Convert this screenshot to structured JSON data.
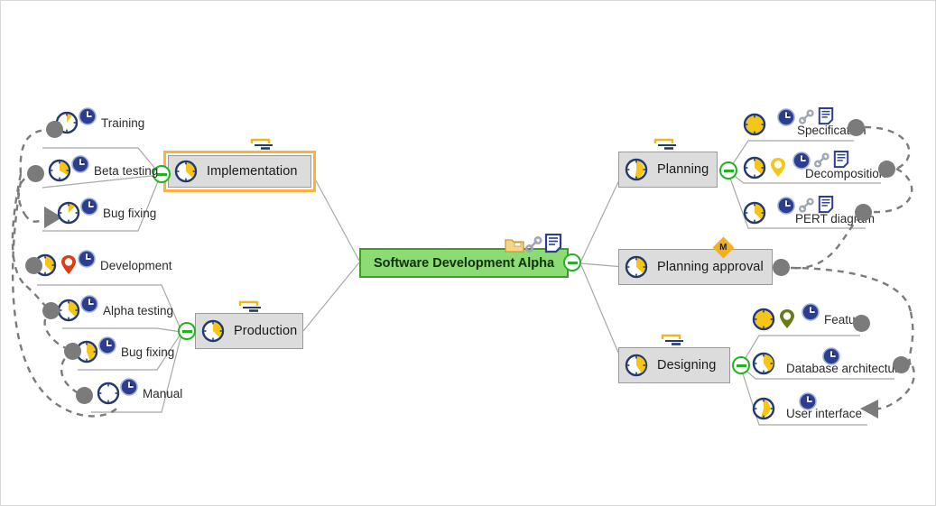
{
  "app": {
    "type": "project-mind-map",
    "background": "#ffffff"
  },
  "colors": {
    "root_fill": "#8ddb74",
    "root_border": "#3d9e26",
    "node_fill": "#dcdcdc",
    "node_border": "#9a9a9a",
    "selection": "#fcb040",
    "collapse": "#23b223",
    "clock_ring": "#22386e",
    "clock_fill": "#f5c518",
    "link_line": "#7b7b7b",
    "branch_line": "#a8a8a8",
    "milestone": "#f2b01e",
    "pin_red": "#e03c12",
    "pin_yellow": "#f5c518",
    "pin_olive": "#6b7a17"
  },
  "root": {
    "label": "Software Development Alpha",
    "progress": 0,
    "icons": [
      "folder-icon",
      "link-icon",
      "note-icon"
    ],
    "collapse_label": "collapse"
  },
  "branches": [
    {
      "id": "implementation",
      "label": "Implementation",
      "selected": true,
      "progress": 30,
      "side": "left",
      "children": [
        {
          "label": "Training",
          "progress": 20,
          "icons": [
            "clock-icon"
          ],
          "endpoint": "dot"
        },
        {
          "label": "Beta testing",
          "progress": 35,
          "icons": [
            "clock-icon"
          ],
          "endpoint": "dot"
        },
        {
          "label": "Bug fixing",
          "progress": 25,
          "icons": [
            "clock-icon"
          ],
          "endpoint": "arrow"
        }
      ]
    },
    {
      "id": "production",
      "label": "Production",
      "selected": false,
      "progress": 30,
      "side": "left",
      "children": [
        {
          "label": "Development",
          "progress": 30,
          "icons": [
            "clock-icon",
            "pin-red-icon"
          ],
          "endpoint": "dot"
        },
        {
          "label": "Alpha testing",
          "progress": 30,
          "icons": [
            "clock-icon"
          ],
          "endpoint": "dot"
        },
        {
          "label": "Bug fixing",
          "progress": 45,
          "icons": [
            "clock-icon"
          ],
          "endpoint": "dot"
        },
        {
          "label": "Manual",
          "progress": 0,
          "icons": [
            "clock-icon"
          ],
          "endpoint": "dot"
        }
      ]
    },
    {
      "id": "planning",
      "label": "Planning",
      "selected": false,
      "progress": 55,
      "side": "right",
      "children": [
        {
          "label": "Specification",
          "progress": 100,
          "icons": [
            "clock-icon",
            "chain-icon",
            "note-icon"
          ],
          "endpoint": "dot"
        },
        {
          "label": "Decomposition",
          "progress": 30,
          "icons": [
            "clock-icon",
            "chain-icon",
            "note-icon",
            "pin-yellow-icon"
          ],
          "endpoint": "dot"
        },
        {
          "label": "PERT diagram",
          "progress": 30,
          "icons": [
            "clock-icon",
            "chain-icon",
            "note-icon"
          ],
          "endpoint": "dot"
        }
      ]
    },
    {
      "id": "planning-approval",
      "label": "Planning approval",
      "selected": false,
      "progress": 30,
      "side": "right",
      "milestone": "M",
      "children": []
    },
    {
      "id": "designing",
      "label": "Designing",
      "selected": false,
      "progress": 35,
      "side": "right",
      "children": [
        {
          "label": "Feature",
          "progress": 100,
          "icons": [
            "clock-icon",
            "pin-olive-icon"
          ],
          "endpoint": "dot"
        },
        {
          "label": "Database architecture",
          "progress": 35,
          "icons": [
            "clock-icon"
          ],
          "endpoint": "dot"
        },
        {
          "label": "User interface",
          "progress": 55,
          "icons": [
            "clock-icon"
          ],
          "endpoint": "arrow"
        }
      ]
    }
  ]
}
